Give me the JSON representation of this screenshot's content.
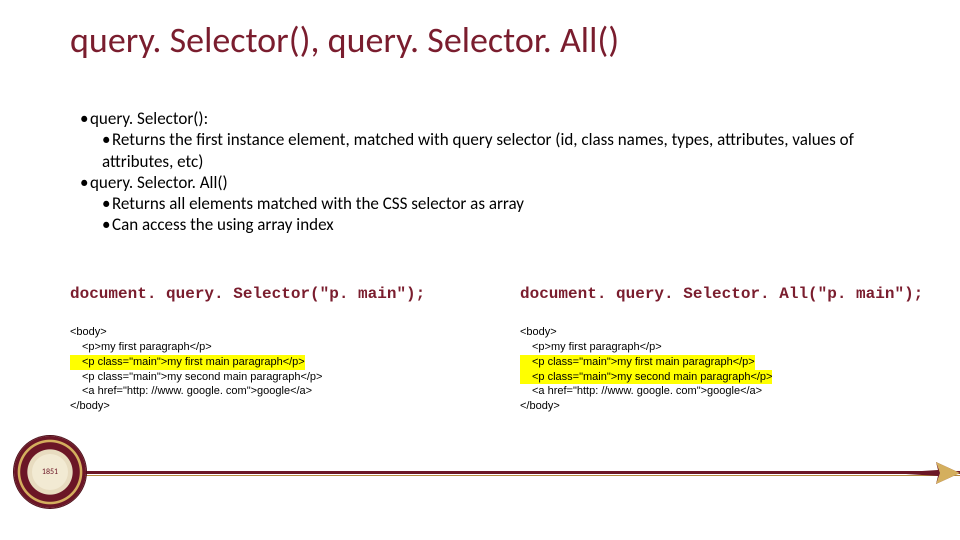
{
  "title": "query. Selector(), query. Selector. All()",
  "bullets": {
    "b0": "query. Selector():",
    "b0_sub": "Returns the first instance element, matched with query selector (id, class names, types, attributes, values of attributes, etc)",
    "b1": "query. Selector. All()",
    "b1_sub_a": "Returns all elements matched with the CSS selector as array",
    "b1_sub_b": "Can access the using array index"
  },
  "left": {
    "cmd": "document. query. Selector(\"p. main\");",
    "ln1": "<body>",
    "ln2": "<p>my first paragraph</p>",
    "ln3": "<p class=\"main\">my first main paragraph</p>",
    "ln4": "<p class=\"main\">my second main paragraph</p>",
    "ln5": "<a href=\"http: //www. google. com\">google</a>",
    "ln6": "</body>"
  },
  "right": {
    "cmd": "document. query. Selector. All(\"p. main\");",
    "ln1": "<body>",
    "ln2": "<p>my first paragraph</p>",
    "ln3": "<p class=\"main\">my first main paragraph</p>",
    "ln4": "<p class=\"main\">my second main paragraph</p>",
    "ln5": "<a href=\"http: //www. google. com\">google</a>",
    "ln6": "</body>"
  },
  "seal_year": "1851"
}
